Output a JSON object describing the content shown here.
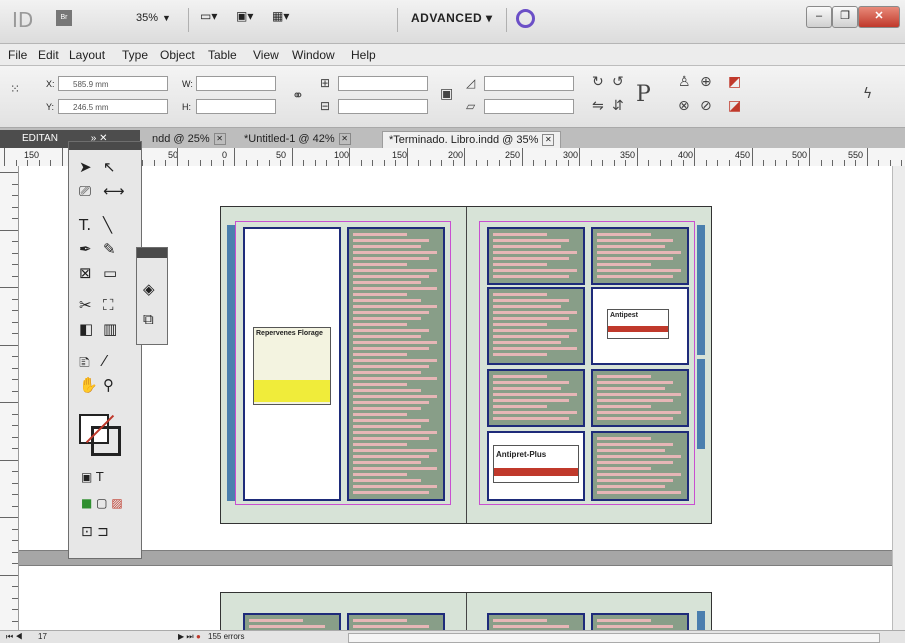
{
  "app": {
    "logo": "ID",
    "bridge": "Br",
    "zoom": "35%",
    "workspace": "ADVANCED",
    "window_buttons": [
      "–",
      "❐",
      "✕"
    ]
  },
  "menu": [
    "File",
    "Edit",
    "Layout",
    "Type",
    "Object",
    "Table",
    "View",
    "Window",
    "Help"
  ],
  "control": {
    "x_label": "X:",
    "x_value": "585.9 mm",
    "y_label": "Y:",
    "y_value": "246.5 mm",
    "w_label": "W:",
    "h_label": "H:"
  },
  "tabs": [
    {
      "label": "EDITAN",
      "active": false
    },
    {
      "label": "ndd @ 25%",
      "active": false
    },
    {
      "label": "*Untitled-1 @ 42%",
      "active": false
    },
    {
      "label": "*Terminado. Libro.indd @ 35%",
      "active": true
    }
  ],
  "ruler": {
    "h_labels": [
      "150",
      "100",
      "50",
      "0",
      "50",
      "100",
      "150",
      "200",
      "250",
      "300",
      "350",
      "400",
      "450",
      "500",
      "550"
    ]
  },
  "ads": {
    "left_title": "Repervenes Florage",
    "right_brand_1": "Antipest",
    "right_brand_2": "Antipret-Plus"
  },
  "status": {
    "page": "17",
    "error": "155 errors"
  },
  "colors": {
    "spread_bg": "#d7e3d7",
    "column_green": "#889e88",
    "frame_blue": "#1e2b7a",
    "guide_magenta": "#c84fd0",
    "accent_purple": "#6b4fc7"
  }
}
